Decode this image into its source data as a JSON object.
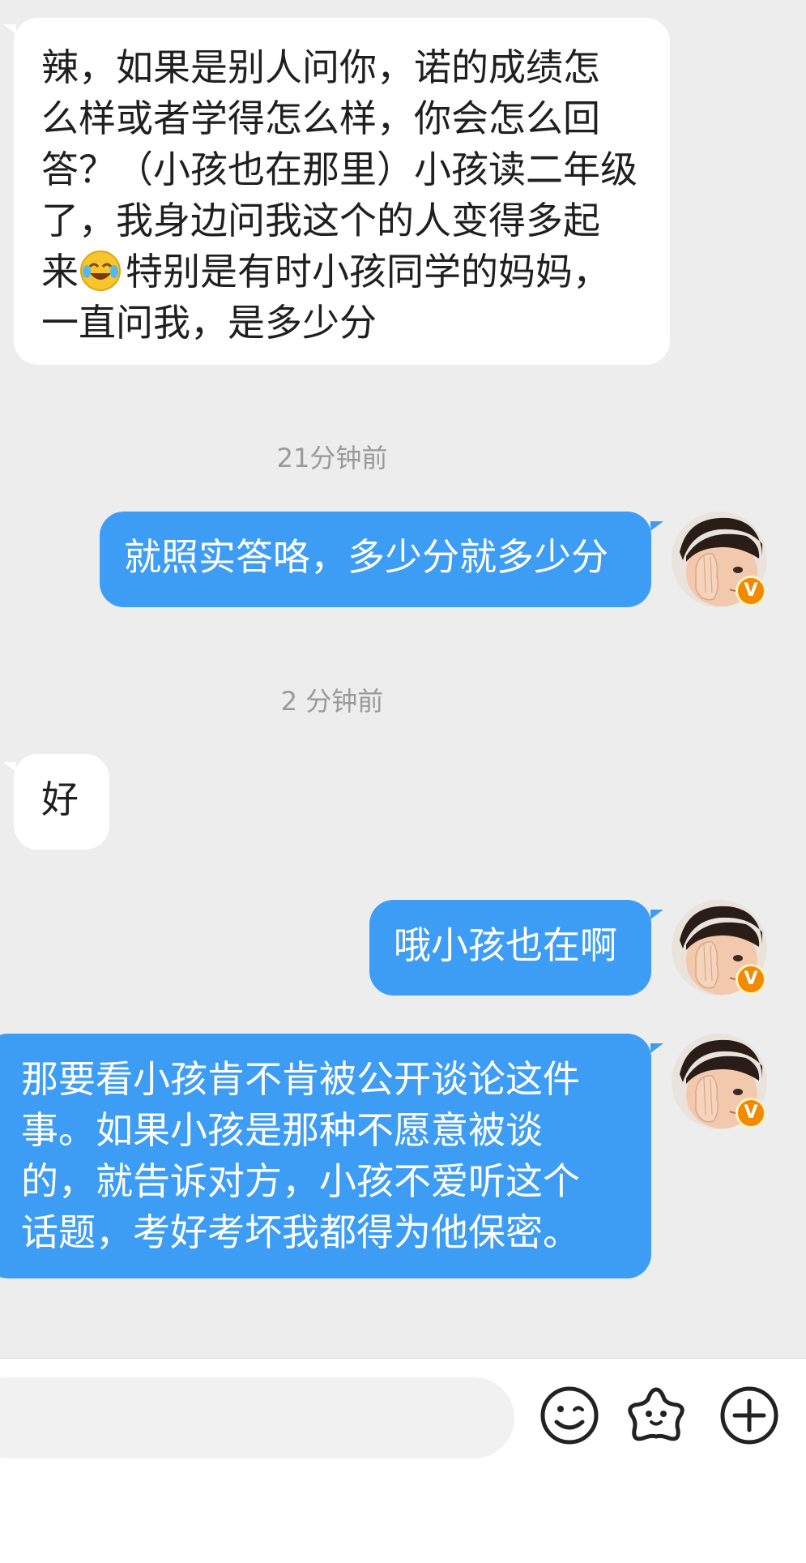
{
  "messages": [
    {
      "side": "incoming",
      "text": "辣，如果是别人问你，诺的成绩怎\n么样或者学得怎么样，你会怎么回\n答？（小孩也在那里）小孩读二年级\n了，我身边问我这个的人变得多起\n来",
      "text_after_emoji": "特别是有时小孩同学的妈妈，\n一直问我，是多少分"
    },
    {
      "side": "outgoing",
      "text": "就照实答咯，多少分就多少分"
    },
    {
      "side": "incoming",
      "text": "好"
    },
    {
      "side": "outgoing",
      "text": "哦小孩也在啊"
    },
    {
      "side": "outgoing",
      "text": "那要看小孩肯不肯被公开谈论这件\n事。如果小孩是那种不愿意被谈\n的，就告诉对方，小孩不爱听这个\n话题，考好考坏我都得为他保密。"
    }
  ],
  "timestamps": [
    "21分钟前",
    "2 分钟前"
  ],
  "avatar_badge": "V",
  "toolbar": {
    "icons": [
      "emoji-icon",
      "sticker-icon",
      "plus-icon"
    ]
  },
  "colors": {
    "background": "#ededed",
    "outgoing_bubble": "#3d9df5",
    "incoming_bubble": "#ffffff",
    "badge": "#f28a00"
  }
}
